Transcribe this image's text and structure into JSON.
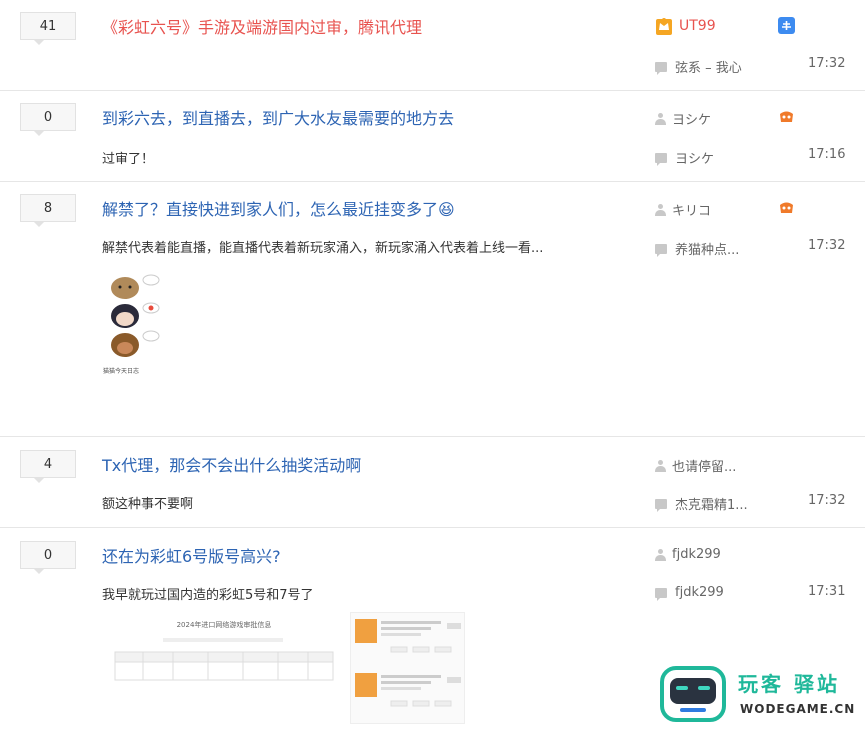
{
  "threads": [
    {
      "count": "41",
      "title": "《彩虹六号》手游及端游国内过审，腾讯代理",
      "author": "UT99",
      "last_reply": "弦系 – 我心",
      "time": "17:32",
      "abstract": ""
    },
    {
      "count": "0",
      "title": "到彩六去，到直播去，到广大水友最需要的地方去",
      "author": "ヨシケ",
      "last_reply": "ヨシケ",
      "time": "17:16",
      "abstract": "过审了！"
    },
    {
      "count": "8",
      "title": "解禁了？直接快进到家人们，怎么最近挂变多了😆",
      "author": "キリコ",
      "last_reply": "养猫种点...",
      "time": "17:32",
      "abstract": "解禁代表着能直播，能直播代表着新玩家涌入，新玩家涌入代表着上线一看..."
    },
    {
      "count": "4",
      "title": "Tx代理，那会不会出什么抽奖活动啊",
      "author": "也请停留...",
      "last_reply": "杰克霜精1...",
      "time": "17:32",
      "abstract": "额这种事不要啊"
    },
    {
      "count": "0",
      "title": "还在为彩虹6号版号高兴?",
      "author": "fjdk299",
      "last_reply": "fjdk299",
      "time": "17:31",
      "abstract": "我早就玩过国内造的彩虹5号和7号了"
    }
  ],
  "images": {
    "doc_title": "2024年进口网络游戏审批信息",
    "meme_caption": "猫猫今天日志"
  },
  "watermark": {
    "brand": "玩客 驿站",
    "url": "WODEGAME.CN"
  },
  "colors": {
    "link": "#2d64b3",
    "hot": "#e8534f",
    "brand_teal": "#1fb89a",
    "brand_blue": "#2f7be0"
  }
}
